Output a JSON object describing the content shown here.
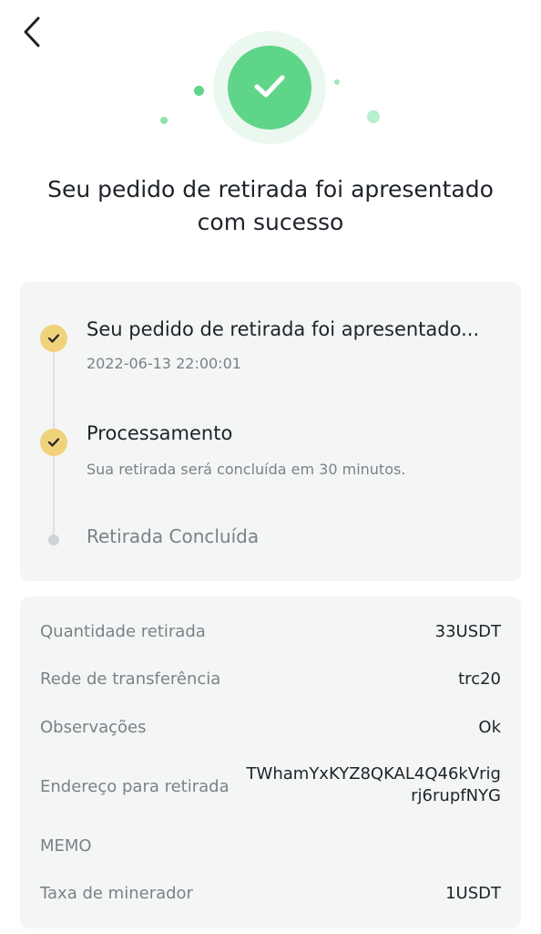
{
  "header": {
    "back_icon": "chevron-left-icon"
  },
  "hero": {
    "icon": "checkmark-icon",
    "color": "#5fd58a"
  },
  "title": {
    "line1": "Seu pedido de retirada foi apresentado",
    "line2": "com sucesso"
  },
  "steps": [
    {
      "title": "Seu pedido de retirada foi apresentado...",
      "subtitle": "2022-06-13 22:00:01",
      "status": "done"
    },
    {
      "title": "Processamento",
      "subtitle": "Sua retirada será concluída em 30 minutos.",
      "status": "done"
    },
    {
      "title": "Retirada Concluída",
      "subtitle": "",
      "status": "pending"
    }
  ],
  "details": {
    "amount": {
      "label": "Quantidade retirada",
      "value": "33USDT"
    },
    "network": {
      "label": "Rede de transferência",
      "value": "trc20"
    },
    "notes": {
      "label": "Observações",
      "value": "Ok"
    },
    "address": {
      "label": "Endereço para retirada",
      "value_line1": "TWhamYxKYZ8QKAL4Q46kVrig",
      "value_line2": "rj6rupfNYG"
    },
    "memo": {
      "label": "MEMO",
      "value": ""
    },
    "fee": {
      "label": "Taxa de minerador",
      "value": "1USDT"
    }
  },
  "colors": {
    "accent_yellow": "#f0d27a",
    "success_green": "#5fd58a",
    "card_bg": "#f4f5f5"
  }
}
